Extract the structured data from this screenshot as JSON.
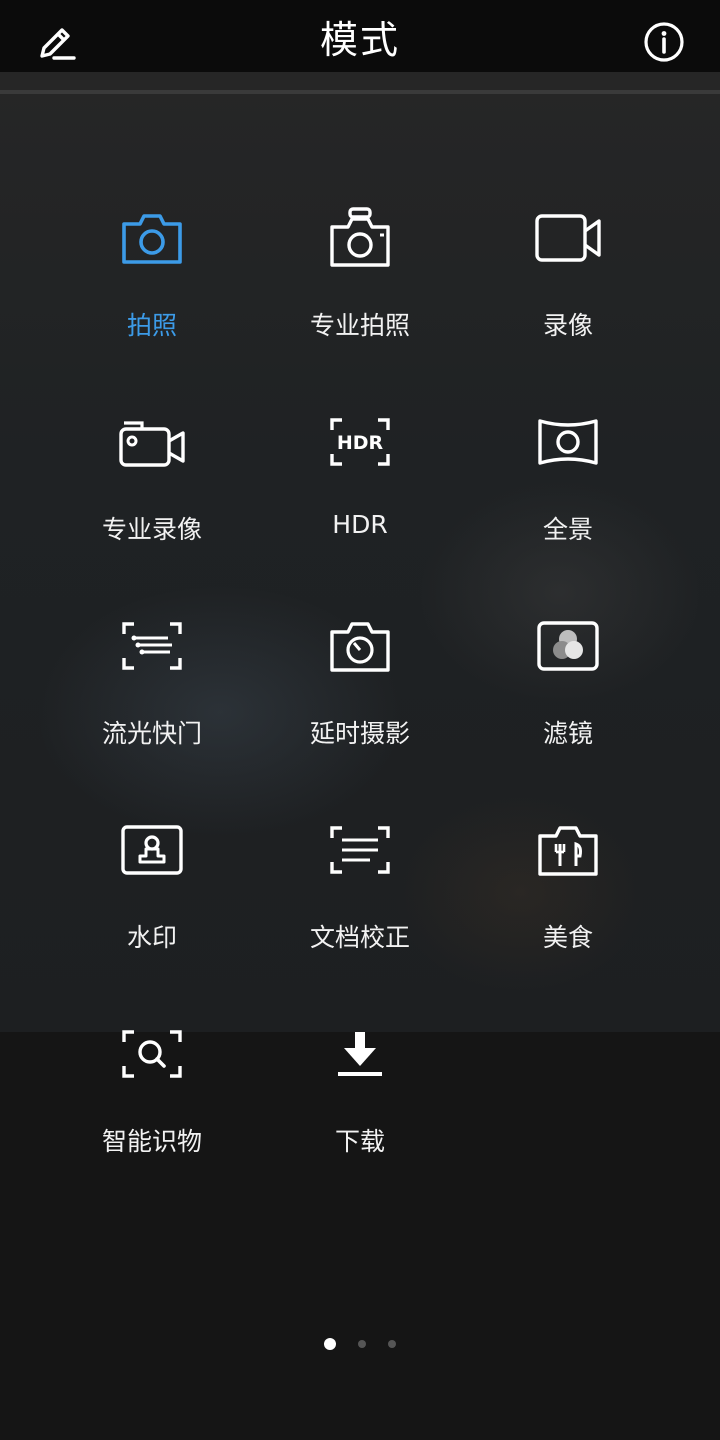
{
  "header": {
    "title": "模式",
    "edit_icon": "pencil-icon",
    "info_icon": "info-icon"
  },
  "colors": {
    "accent": "#3c9be8",
    "background": "#151515",
    "header": "#0b0b0b"
  },
  "modes": [
    {
      "label": "拍照",
      "icon": "camera-icon",
      "active": true
    },
    {
      "label": "专业拍照",
      "icon": "pro-camera-icon",
      "active": false
    },
    {
      "label": "录像",
      "icon": "video-icon",
      "active": false
    },
    {
      "label": "专业录像",
      "icon": "pro-video-icon",
      "active": false
    },
    {
      "label": "HDR",
      "icon": "hdr-icon",
      "active": false
    },
    {
      "label": "全景",
      "icon": "panorama-icon",
      "active": false
    },
    {
      "label": "流光快门",
      "icon": "light-painting-icon",
      "active": false
    },
    {
      "label": "延时摄影",
      "icon": "time-lapse-icon",
      "active": false
    },
    {
      "label": "滤镜",
      "icon": "filter-icon",
      "active": false
    },
    {
      "label": "水印",
      "icon": "watermark-icon",
      "active": false
    },
    {
      "label": "文档校正",
      "icon": "document-correction-icon",
      "active": false
    },
    {
      "label": "美食",
      "icon": "food-icon",
      "active": false
    },
    {
      "label": "智能识物",
      "icon": "object-recognition-icon",
      "active": false
    },
    {
      "label": "下载",
      "icon": "download-icon",
      "active": false
    }
  ],
  "pagination": {
    "pages": 3,
    "current": 1
  }
}
